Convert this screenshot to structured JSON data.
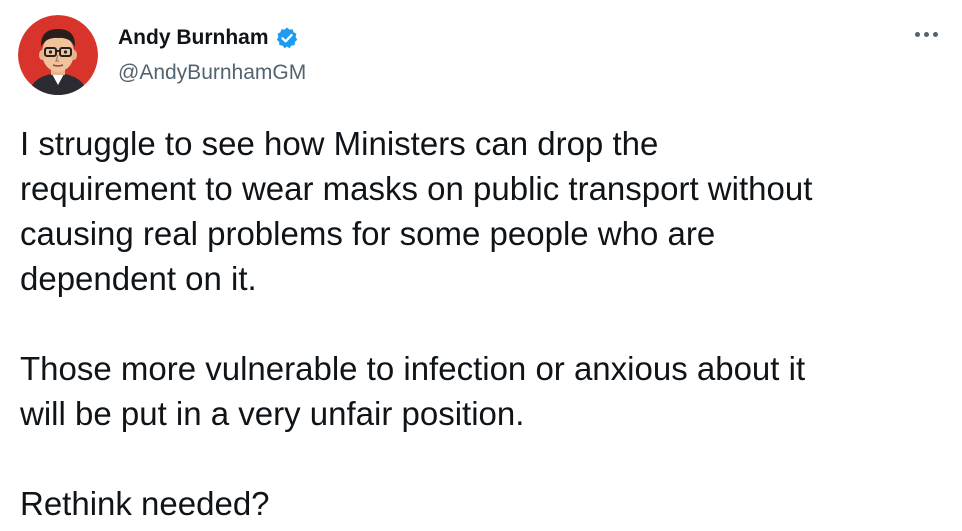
{
  "tweet": {
    "author": {
      "display_name": "Andy Burnham",
      "handle": "@AndyBurnhamGM",
      "verified": true,
      "verified_color": "#1d9bf0",
      "avatar_icon": "cartoon-portrait-avatar",
      "avatar_bg": "#d9342b"
    },
    "more_icon": "more-options-icon",
    "paragraphs": [
      "I struggle to see how Ministers can drop the\nrequirement to wear masks on public transport without\ncausing real problems for some people who are\ndependent on it.",
      "Those more vulnerable to infection or anxious about it\nwill be put in a very unfair position.",
      "Rethink needed?"
    ]
  }
}
